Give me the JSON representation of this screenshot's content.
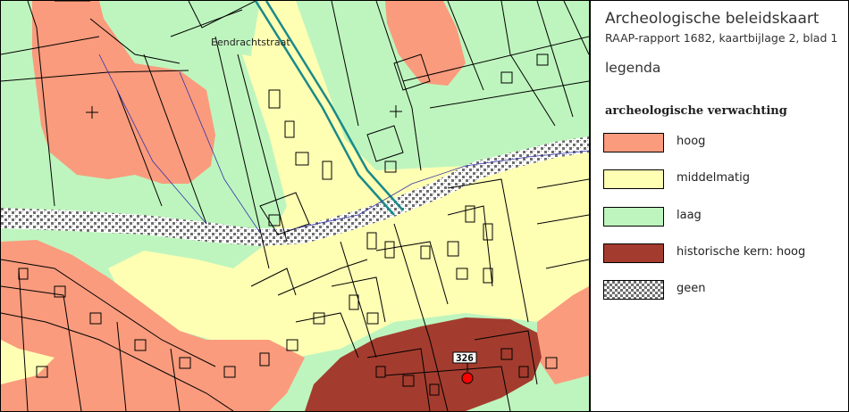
{
  "legend": {
    "title": "Archeologische beleidskaart",
    "subtitle": "RAAP-rapport 1682, kaartbijlage 2, blad 1",
    "heading": "legenda",
    "section": "archeologische verwachting",
    "items": [
      {
        "label": "hoog",
        "color": "#fa9b7d",
        "pattern": false
      },
      {
        "label": "middelmatig",
        "color": "#ffffb4",
        "pattern": false
      },
      {
        "label": "laag",
        "color": "#bef5be",
        "pattern": false
      },
      {
        "label": "historische kern: hoog",
        "color": "#a33c2e",
        "pattern": false
      },
      {
        "label": "geen",
        "color": "#ffffff",
        "pattern": true
      }
    ]
  },
  "map": {
    "street_label": "Eendrachtstraat",
    "site_marker": {
      "label": "326",
      "color": "#ff0000",
      "icon": "site-marker-icon"
    },
    "colors": {
      "hoog": "#fa9b7d",
      "middelmatig": "#ffffb4",
      "laag": "#bef5be",
      "historische_kern": "#a33c2e",
      "canal": "#1a8a8a",
      "parcel_line": "#000000",
      "road_line": "#3333aa"
    }
  }
}
